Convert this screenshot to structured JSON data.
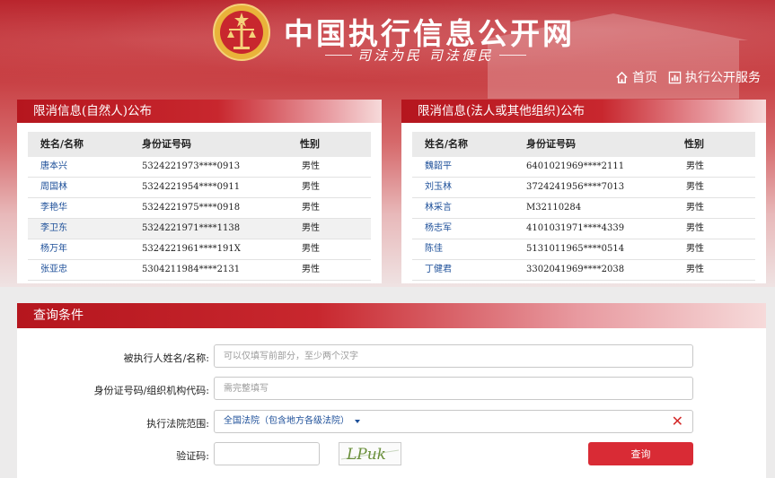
{
  "site": {
    "title": "中国执行信息公开网",
    "slogan": "司法为民  司法便民"
  },
  "topnav": [
    {
      "label": "首页",
      "icon": "home-icon"
    },
    {
      "label": "执行公开服务",
      "icon": "chart-icon"
    }
  ],
  "persons_panel": {
    "title": "限消信息(自然人)公布",
    "headers": [
      "姓名/名称",
      "身份证号码",
      "性别"
    ],
    "rows": [
      [
        "唐本兴",
        "5324221973****0913",
        "男性"
      ],
      [
        "周国林",
        "5324221954****0911",
        "男性"
      ],
      [
        "李艳华",
        "5324221975****0918",
        "男性"
      ],
      [
        "李卫东",
        "5324221971****1138",
        "男性"
      ],
      [
        "杨万年",
        "5324221961****191X",
        "男性"
      ],
      [
        "张亚忠",
        "5304211984****2131",
        "男性"
      ]
    ]
  },
  "orgs_panel": {
    "title": "限消信息(法人或其他组织)公布",
    "headers": [
      "姓名/名称",
      "身份证号码",
      "性别"
    ],
    "rows": [
      [
        "魏韶平",
        "6401021969****2111",
        "男性"
      ],
      [
        "刘玉林",
        "3724241956****7013",
        "男性"
      ],
      [
        "林采言",
        "M32110284",
        "男性"
      ],
      [
        "杨志军",
        "4101031971****4339",
        "男性"
      ],
      [
        "陈佳",
        "5131011965****0514",
        "男性"
      ],
      [
        "丁健君",
        "3302041969****2038",
        "男性"
      ]
    ]
  },
  "query": {
    "title": "查询条件",
    "name_label": "被执行人姓名/名称:",
    "name_placeholder": "可以仅填写前部分，至少两个汉字",
    "id_label": "身份证号码/组织机构代码:",
    "id_placeholder": "需完整填写",
    "court_label": "执行法院范围:",
    "court_value": "全国法院（包含地方各级法院）",
    "captcha_label": "验证码:",
    "captcha_text": "LPuk",
    "submit_label": "查询"
  },
  "colors": {
    "brand_red": "#c8272e",
    "link_blue": "#1d4f99",
    "button_red": "#d92b35"
  }
}
